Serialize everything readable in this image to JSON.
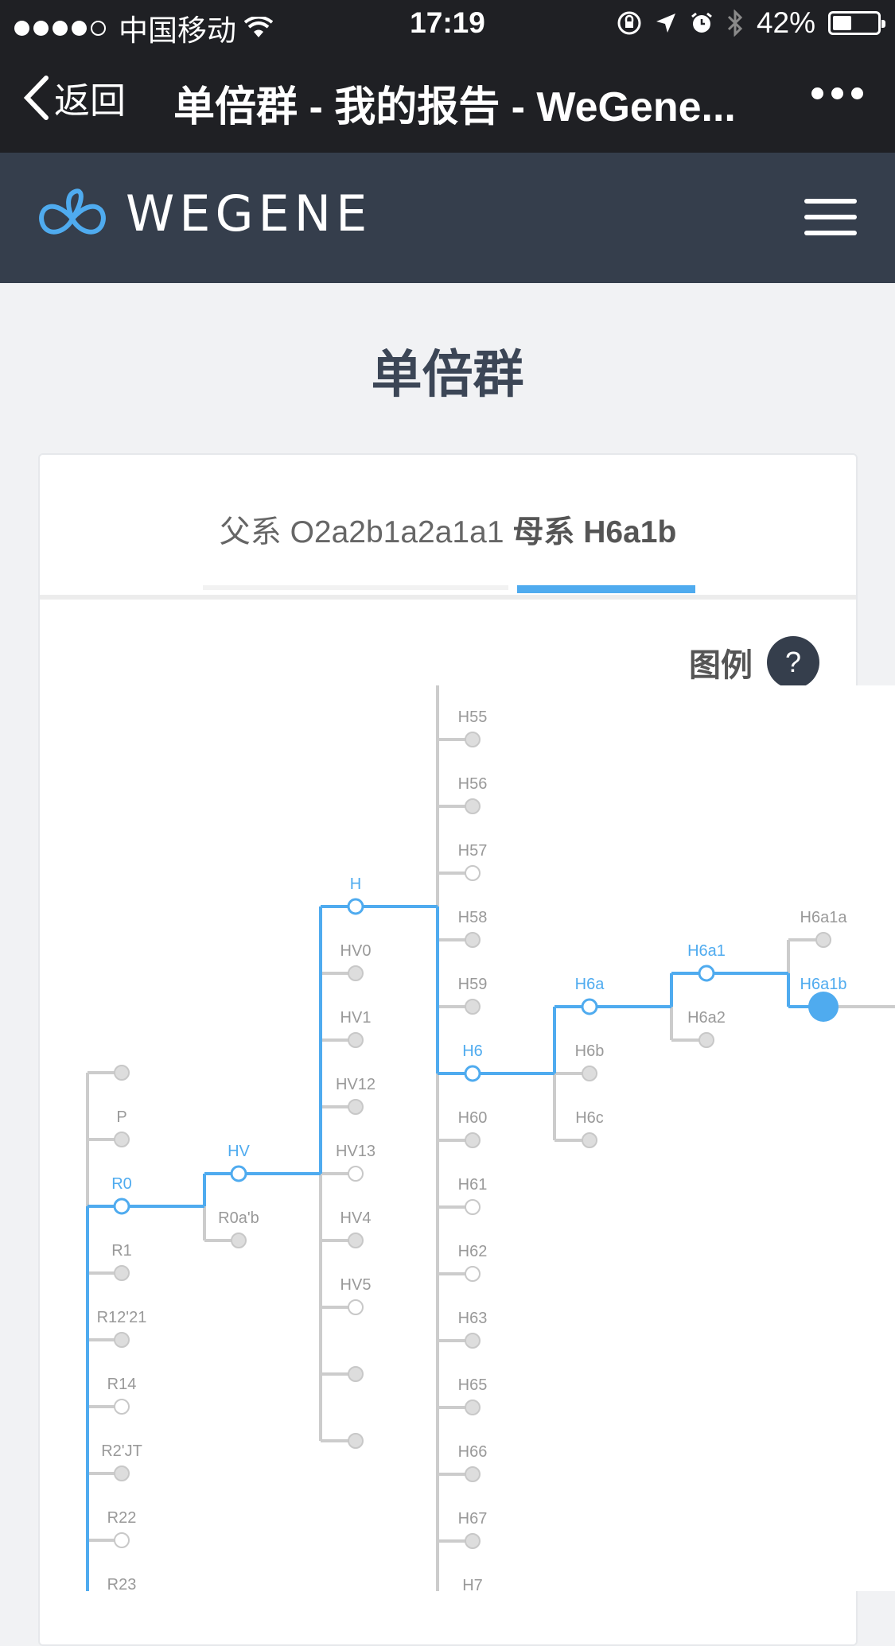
{
  "status": {
    "carrier": "中国移动",
    "time": "17:19",
    "battery": "42%",
    "battery_level": 0.42
  },
  "nav": {
    "back_label": "返回",
    "title": "单倍群 - 我的报告 - WeGene..."
  },
  "site": {
    "logo_text": "WEGENE"
  },
  "page": {
    "title": "单倍群"
  },
  "tabs": {
    "paternal_label": "父系",
    "paternal_value": "O2a2b1a2a1a1",
    "maternal_label": "母系",
    "maternal_value": "H6a1b"
  },
  "legend": {
    "label": "图例",
    "button": "?"
  },
  "colors": {
    "accent": "#4fabef",
    "header_bg": "#353e4c",
    "topbar_bg": "#1f2024",
    "line_gray": "#cccccc",
    "node_gray": "#dddddd"
  },
  "tree": {
    "columns": [
      {
        "name": "r-column",
        "nodes": [
          {
            "label": "",
            "state": "filled"
          },
          {
            "label": "P",
            "state": "filled"
          },
          {
            "label": "R0",
            "state": "path"
          },
          {
            "label": "R1",
            "state": "filled"
          },
          {
            "label": "R12'21",
            "state": "filled"
          },
          {
            "label": "R14",
            "state": "empty"
          },
          {
            "label": "R2'JT",
            "state": "filled"
          },
          {
            "label": "R22",
            "state": "empty"
          },
          {
            "label": "R23",
            "state": "filled"
          }
        ]
      },
      {
        "name": "hv-column",
        "nodes": [
          {
            "label": "HV",
            "state": "path"
          },
          {
            "label": "R0a'b",
            "state": "filled"
          }
        ]
      },
      {
        "name": "h-column",
        "nodes": [
          {
            "label": "H",
            "state": "path"
          },
          {
            "label": "HV0",
            "state": "filled"
          },
          {
            "label": "HV1",
            "state": "filled"
          },
          {
            "label": "HV12",
            "state": "filled"
          },
          {
            "label": "HV13",
            "state": "empty"
          },
          {
            "label": "HV4",
            "state": "filled"
          },
          {
            "label": "HV5",
            "state": "empty"
          },
          {
            "label": "",
            "state": "filled"
          },
          {
            "label": "",
            "state": "filled"
          }
        ]
      },
      {
        "name": "h-sub-column",
        "nodes": [
          {
            "label": "H55",
            "state": "filled"
          },
          {
            "label": "H56",
            "state": "filled"
          },
          {
            "label": "H57",
            "state": "empty"
          },
          {
            "label": "H58",
            "state": "filled"
          },
          {
            "label": "H59",
            "state": "filled"
          },
          {
            "label": "H6",
            "state": "path"
          },
          {
            "label": "H60",
            "state": "filled"
          },
          {
            "label": "H61",
            "state": "empty"
          },
          {
            "label": "H62",
            "state": "empty"
          },
          {
            "label": "H63",
            "state": "filled"
          },
          {
            "label": "H65",
            "state": "filled"
          },
          {
            "label": "H66",
            "state": "filled"
          },
          {
            "label": "H67",
            "state": "filled"
          },
          {
            "label": "H7",
            "state": "filled"
          }
        ]
      },
      {
        "name": "h6-column",
        "nodes": [
          {
            "label": "H6a",
            "state": "path"
          },
          {
            "label": "H6b",
            "state": "filled"
          },
          {
            "label": "H6c",
            "state": "filled"
          }
        ]
      },
      {
        "name": "h6a-column",
        "nodes": [
          {
            "label": "H6a1",
            "state": "path"
          },
          {
            "label": "H6a2",
            "state": "filled"
          }
        ]
      },
      {
        "name": "h6a1-column",
        "nodes": [
          {
            "label": "H6a1a",
            "state": "filled"
          },
          {
            "label": "H6a1b",
            "state": "current"
          }
        ]
      }
    ]
  }
}
